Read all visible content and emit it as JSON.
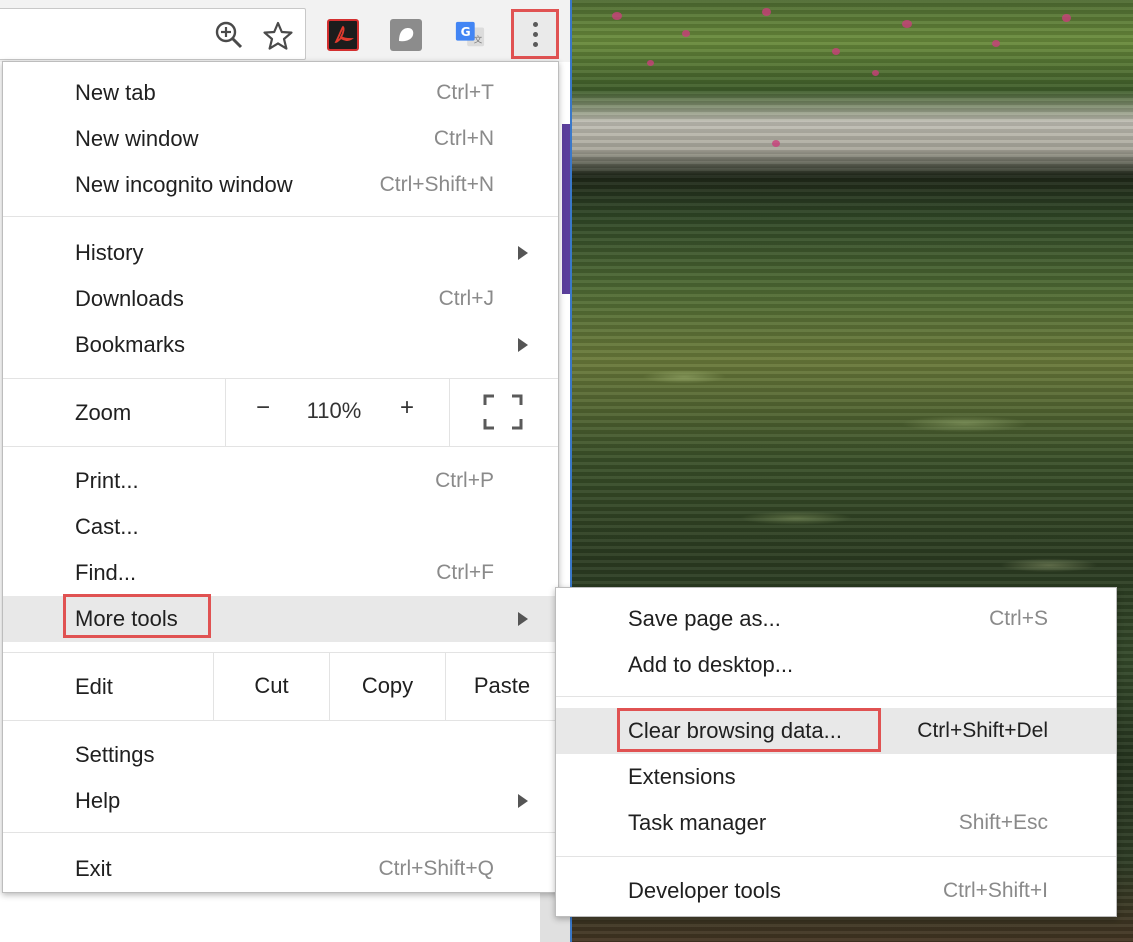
{
  "colors": {
    "highlight": "#e05252",
    "menu_bg": "#ffffff",
    "hover_bg": "#e8e8e8",
    "shortcut_text": "#8a8a8a",
    "accent_blue": "#3a78c9"
  },
  "toolbar": {
    "icons": [
      "zoom-in-icon",
      "star-icon",
      "acrobat-extension-icon",
      "ghostery-extension-icon",
      "google-translate-extension-icon",
      "more-vertical-icon"
    ]
  },
  "menu": {
    "items_top": [
      {
        "label": "New tab",
        "shortcut": "Ctrl+T"
      },
      {
        "label": "New window",
        "shortcut": "Ctrl+N"
      },
      {
        "label": "New incognito window",
        "shortcut": "Ctrl+Shift+N"
      }
    ],
    "items_nav": [
      {
        "label": "History",
        "shortcut": ""
      },
      {
        "label": "Downloads",
        "shortcut": "Ctrl+J"
      },
      {
        "label": "Bookmarks",
        "shortcut": ""
      }
    ],
    "zoom": {
      "label": "Zoom",
      "minus": "−",
      "value": "110%",
      "plus": "+"
    },
    "items_tools": [
      {
        "label": "Print...",
        "shortcut": "Ctrl+P"
      },
      {
        "label": "Cast...",
        "shortcut": ""
      },
      {
        "label": "Find...",
        "shortcut": "Ctrl+F"
      },
      {
        "label": "More tools",
        "shortcut": ""
      }
    ],
    "edit": {
      "label": "Edit",
      "cut": "Cut",
      "copy": "Copy",
      "paste": "Paste"
    },
    "items_settings": [
      {
        "label": "Settings",
        "shortcut": ""
      },
      {
        "label": "Help",
        "shortcut": ""
      }
    ],
    "exit": {
      "label": "Exit",
      "shortcut": "Ctrl+Shift+Q"
    }
  },
  "submenu": {
    "items_a": [
      {
        "label": "Save page as...",
        "shortcut": "Ctrl+S"
      },
      {
        "label": "Add to desktop...",
        "shortcut": ""
      }
    ],
    "items_b": [
      {
        "label": "Clear browsing data...",
        "shortcut": "Ctrl+Shift+Del"
      },
      {
        "label": "Extensions",
        "shortcut": ""
      },
      {
        "label": "Task manager",
        "shortcut": "Shift+Esc"
      }
    ],
    "items_c": [
      {
        "label": "Developer tools",
        "shortcut": "Ctrl+Shift+I"
      }
    ]
  }
}
